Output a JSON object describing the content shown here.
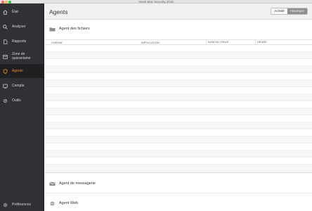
{
  "window": {
    "title": "Avast Mac Security 2015"
  },
  "sidebar": {
    "items": [
      {
        "label": "État",
        "icon": "home-icon"
      },
      {
        "label": "Analyser",
        "icon": "search-icon"
      },
      {
        "label": "Rapports",
        "icon": "document-icon"
      },
      {
        "label": "Zone de quarantaine",
        "icon": "quarantine-icon"
      },
      {
        "label": "Agents",
        "icon": "shield-icon",
        "active": true
      },
      {
        "label": "Compte",
        "icon": "account-icon"
      },
      {
        "label": "Outils",
        "icon": "tools-icon"
      }
    ],
    "preferences_label": "Préférences"
  },
  "header": {
    "title": "Agents",
    "segment": {
      "activity": "Activité",
      "history": "Historique",
      "selected": "Activité"
    }
  },
  "file_agent": {
    "label": "Agent des fichiers",
    "columns": [
      "CHEMIN",
      "APPLICATION",
      "NOM DU VIRUS",
      "HEURE"
    ],
    "rows": []
  },
  "mail_agent": {
    "label": "Agent de messagerie"
  },
  "web_agent": {
    "label": "Agent Web"
  },
  "colors": {
    "accent": "#f08a1a",
    "sidebar_bg": "#2f3134",
    "sidebar_active_bg": "#1f2022"
  }
}
